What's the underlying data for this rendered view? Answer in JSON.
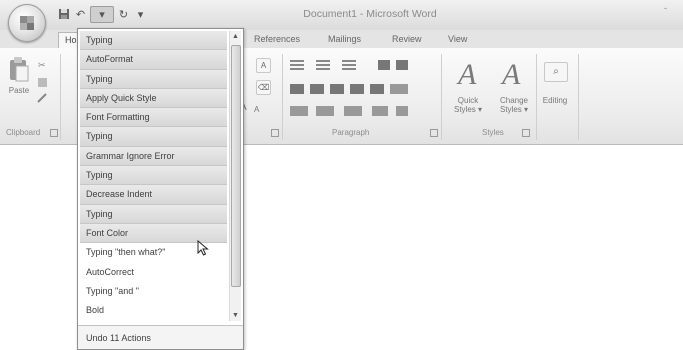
{
  "window": {
    "title": "Document1 - Microsoft Word",
    "minimize": "-"
  },
  "quick_access": {
    "undo": "↶",
    "arrow": "▾",
    "redo": "↻",
    "more": "▾"
  },
  "tabs": [
    "Ho",
    "References",
    "Mailings",
    "Review",
    "View"
  ],
  "ribbon": {
    "paste_label": "Paste",
    "clipboard_group": "Clipboard",
    "paragraph_group": "Paragraph",
    "styles_group": "Styles",
    "quick_styles_label": "Quick Styles ▾",
    "change_styles_label": "Change Styles ▾",
    "editing_label": "Editing"
  },
  "undo_list": {
    "items": [
      "Typing",
      "AutoFormat",
      "Typing",
      "Apply Quick Style",
      "Font Formatting",
      "Typing",
      "Grammar Ignore Error",
      "Typing",
      "Decrease Indent",
      "Typing",
      "Font Color",
      "Typing \"then what?\"",
      "AutoCorrect",
      "Typing \"and \"",
      "Bold"
    ],
    "selected_count": 11,
    "footer": "Undo 11 Actions"
  },
  "colors": {
    "selection": "#dcdcdc",
    "ribbon": "#efefef"
  }
}
